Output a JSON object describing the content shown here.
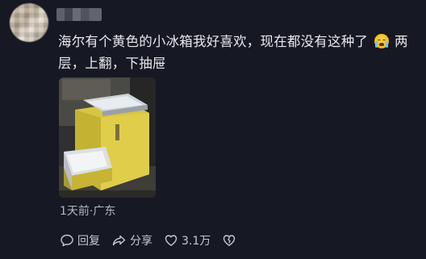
{
  "comment": {
    "text_part1": "海尔有个黄色的小冰箱我好喜欢，现在都没有这种了",
    "emoji": "crying-face",
    "text_part2": "两层，上翻，下抽屉",
    "meta": "1天前·广东"
  },
  "actions": {
    "reply_label": "回复",
    "share_label": "分享",
    "like_count": "3.1万"
  },
  "colors": {
    "background": "#161823",
    "text": "#e9e9ee",
    "muted": "#b7b8bf"
  }
}
